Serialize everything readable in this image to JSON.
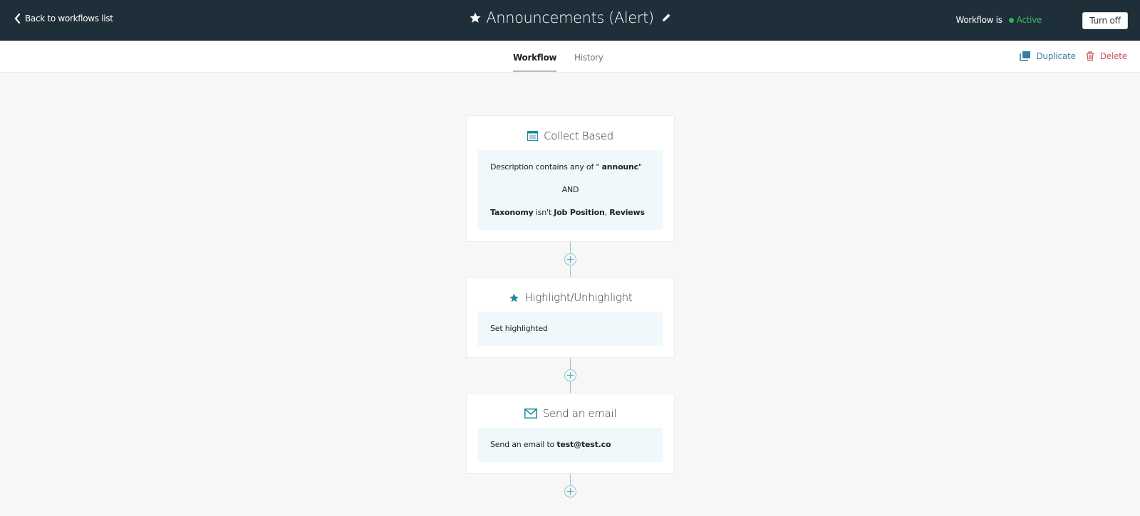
{
  "header": {
    "back_label": "Back to workflows list",
    "title": "Announcements (Alert)",
    "status_label": "Workflow is",
    "status_value": "Active",
    "status_color": "#2cb657",
    "turn_off_label": "Turn off"
  },
  "tabs": [
    {
      "label": "Workflow",
      "active": true
    },
    {
      "label": "History",
      "active": false
    }
  ],
  "actions": {
    "duplicate_label": "Duplicate",
    "delete_label": "Delete"
  },
  "steps": [
    {
      "title": "Collect Based",
      "icon": "list-card-icon",
      "condition1": {
        "pre": "Description contains any of \" ",
        "bold": "announc",
        "post": "\""
      },
      "join": "AND",
      "condition2": {
        "field": "Taxonomy",
        "op": " isn't ",
        "v1": "Job Position",
        "sep": ", ",
        "v2": "Reviews"
      }
    },
    {
      "title": "Highlight/Unhighlight",
      "icon": "star-icon",
      "text": "Set highlighted"
    },
    {
      "title": "Send an email",
      "icon": "envelope-icon",
      "pre": "Send an email to ",
      "bold": "test@test.co"
    }
  ],
  "colors": {
    "header_bg": "#1f2f3a",
    "accent": "#1d8b9b",
    "connector": "#8ccad6",
    "duplicate": "#3a7ea0",
    "delete": "#d0525b"
  }
}
